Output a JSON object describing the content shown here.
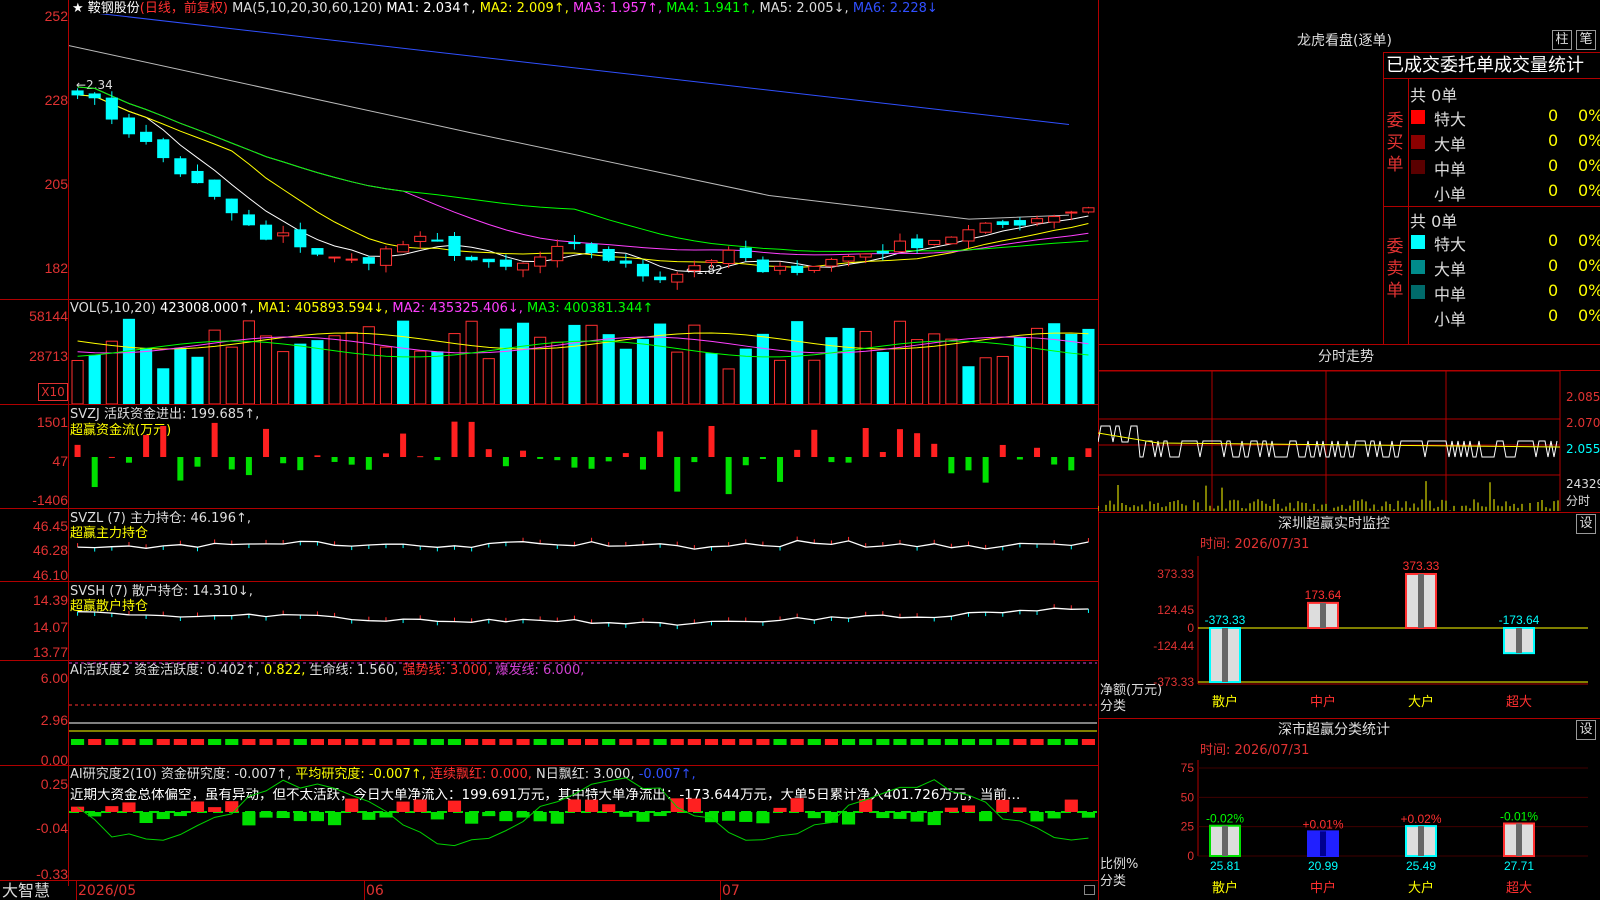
{
  "main": {
    "title": "★ 鞍钢股份",
    "period": "(日线，前复权)",
    "ma_legend": [
      {
        "label": "MA(5,10,20,30,60,120)",
        "color": "#dddddd"
      },
      {
        "label": "MA1: 2.034↑,",
        "color": "#ffffff"
      },
      {
        "label": "MA2: 2.009↑,",
        "color": "#ffff00"
      },
      {
        "label": "MA3: 1.957↑,",
        "color": "#ff40ff"
      },
      {
        "label": "MA4: 1.941↑,",
        "color": "#00ff00"
      },
      {
        "label": "MA5: 2.005↓,",
        "color": "#dddddd"
      },
      {
        "label": "MA6: 2.228↓",
        "color": "#3050ff"
      }
    ],
    "y_ticks": [
      "252",
      "228",
      "205",
      "182"
    ],
    "high_mark": "←2.34",
    "low_mark": "←1.82"
  },
  "vol": {
    "legend": [
      {
        "label": "VOL(5,10,20)",
        "color": "#dddddd"
      },
      {
        "label": "423008.000↑,",
        "color": "#ffffff"
      },
      {
        "label": "MA1: 405893.594↓,",
        "color": "#ffff00"
      },
      {
        "label": "MA2: 435325.406↓,",
        "color": "#ff40ff"
      },
      {
        "label": "MA3: 400381.344↑",
        "color": "#00ff00"
      }
    ],
    "y_ticks": [
      "58144",
      "28713"
    ],
    "unit": "X10"
  },
  "svzj": {
    "legend": "SVZJ  活跃资金进出: 199.685↑,",
    "sub": "超赢资金流(万元)",
    "y_ticks": [
      "1501",
      "47",
      "-1406"
    ]
  },
  "svzl": {
    "legend": "SVZL (7) 主力持仓: 46.196↑,",
    "sub": "超赢主力持仓",
    "y_ticks": [
      "46.45",
      "46.28",
      "46.10"
    ]
  },
  "svsh": {
    "legend": "SVSH (7) 散户持仓: 14.310↓,",
    "sub": "超赢散户持仓",
    "y_ticks": [
      "14.39",
      "14.07",
      "13.77"
    ]
  },
  "ai_active": {
    "legend_parts": [
      {
        "label": "AI活跃度2 资金活跃度: 0.402↑,",
        "color": "#dddddd"
      },
      {
        "label": "0.822,",
        "color": "#ffff00"
      },
      {
        "label": "生命线: 1.560,",
        "color": "#dddddd"
      },
      {
        "label": "强势线: 3.000,",
        "color": "#ff3030"
      },
      {
        "label": "爆发线: 6.000,",
        "color": "#d040d0"
      }
    ],
    "y_ticks": [
      "6.00",
      "2.96",
      "0.00"
    ]
  },
  "ai_research": {
    "legend_parts": [
      {
        "label": "AI研究度2(10) 资金研究度: -0.007↑,",
        "color": "#dddddd"
      },
      {
        "label": "平均研究度: -0.007↑,",
        "color": "#ffff00"
      },
      {
        "label": "连续飘红: 0.000,",
        "color": "#ff3030"
      },
      {
        "label": "N日飘红: 3.000,",
        "color": "#dddddd"
      },
      {
        "label": "-0.007↑,",
        "color": "#3050ff"
      }
    ],
    "comment": "近期大资金总体偏空，虽有异动，但不太活跃，今日大单净流入：199.691万元，其中特大单净流出：-173.644万元，大单5日累计净入401.726万元，当前…",
    "y_ticks": [
      "0.25",
      "-0.04",
      "-0.33"
    ]
  },
  "bottom": {
    "brand": "大智慧",
    "dates": [
      "2026/05",
      "06",
      "07"
    ]
  },
  "right": {
    "lhkp_title": "龙虎看盘(逐单)",
    "btn_zhu": "柱",
    "btn_bi": "笔",
    "stat_header": "已成交委托单成交量统计",
    "buy": {
      "side_label": "委买单",
      "total": "共 0单",
      "rows": [
        {
          "name": "特大",
          "count": "0",
          "pct": "0%",
          "color": "#ff0000"
        },
        {
          "name": "大单",
          "count": "0",
          "pct": "0%",
          "color": "#8b0000"
        },
        {
          "name": "中单",
          "count": "0",
          "pct": "0%",
          "color": "#5a0000"
        },
        {
          "name": "小单",
          "count": "0",
          "pct": "0%",
          "color": "#000000"
        }
      ]
    },
    "sell": {
      "side_label": "委卖单",
      "total": "共 0单",
      "rows": [
        {
          "name": "特大",
          "count": "0",
          "pct": "0%",
          "color": "#00ffff"
        },
        {
          "name": "大单",
          "count": "0",
          "pct": "0%",
          "color": "#008b8b"
        },
        {
          "name": "中单",
          "count": "0",
          "pct": "0%",
          "color": "#006a6a"
        },
        {
          "name": "小单",
          "count": "0",
          "pct": "0%",
          "color": "#000000"
        }
      ]
    },
    "fenshi": {
      "title": "分时走势",
      "y_ticks": [
        "2.085",
        "2.070",
        "2.055"
      ],
      "vol_label": "24329",
      "bottom_label": "分时"
    },
    "sz_monitor": {
      "title": "深圳超赢实时监控",
      "btn": "设",
      "date": "时间: 2026/07/31",
      "y_ticks": [
        "373.33",
        "124.45",
        "0",
        "-124.44",
        "-373.33"
      ],
      "y_label": "净额(万元)",
      "x_label": "分类",
      "categories": [
        "散户",
        "中户",
        "大户",
        "超大"
      ],
      "values": [
        -373.33,
        173.64,
        373.33,
        -173.64
      ],
      "value_labels": [
        "-373.33",
        "173.64",
        "373.33",
        "-173.64"
      ]
    },
    "sm_stats": {
      "title": "深市超赢分类统计",
      "btn": "设",
      "date": "时间: 2026/07/31",
      "y_ticks": [
        "75",
        "50",
        "25",
        "0"
      ],
      "y_label": "比例%",
      "x_label": "分类",
      "categories": [
        "散户",
        "中户",
        "大户",
        "超大"
      ],
      "values": [
        25.81,
        20.99,
        25.49,
        27.71
      ],
      "changes": [
        "-0.02%",
        "+0.01%",
        "+0.02%",
        "-0.01%"
      ]
    }
  }
}
